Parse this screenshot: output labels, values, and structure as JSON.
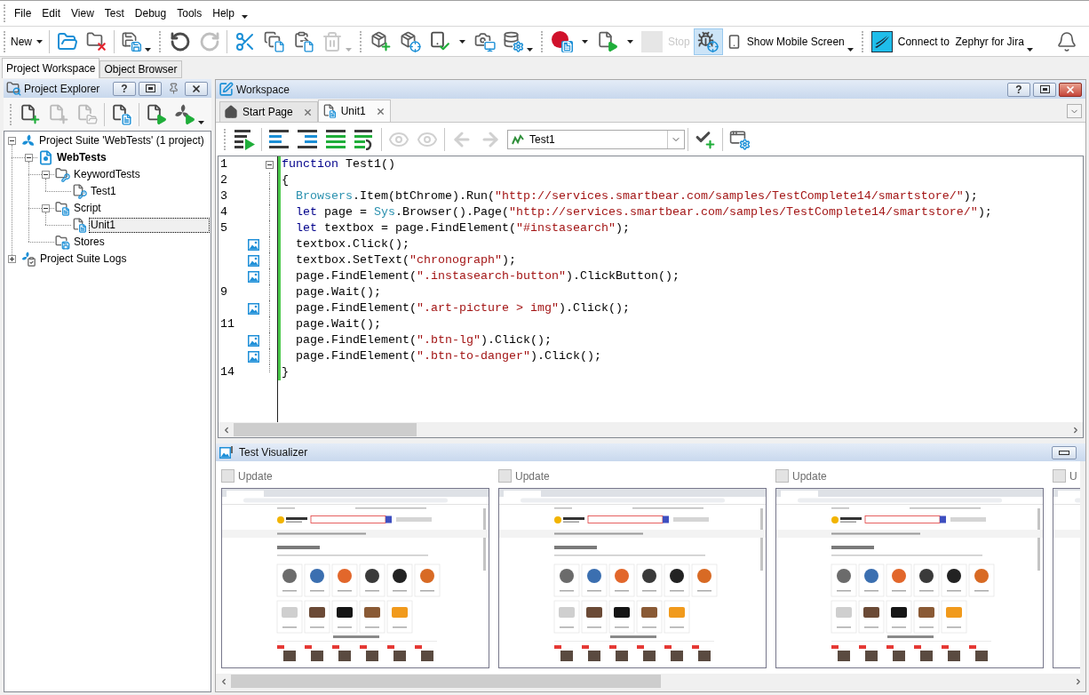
{
  "menu_bar": [
    {
      "label": "File"
    },
    {
      "label": "Edit"
    },
    {
      "label": "View"
    },
    {
      "label": "Test"
    },
    {
      "label": "Debug"
    },
    {
      "label": "Tools"
    },
    {
      "label": "Help"
    }
  ],
  "toolbar": {
    "items": [
      {
        "kind": "menu",
        "label": "New"
      },
      {
        "kind": "separator"
      },
      {
        "kind": "button",
        "disabled": false
      },
      {
        "kind": "button",
        "disabled": false
      },
      {
        "kind": "separator"
      },
      {
        "kind": "dropdown-button",
        "disabled": false
      },
      {
        "kind": "gripper"
      },
      {
        "kind": "button",
        "disabled": false
      },
      {
        "kind": "button",
        "disabled": true
      },
      {
        "kind": "separator"
      },
      {
        "kind": "button",
        "disabled": false
      },
      {
        "kind": "button",
        "disabled": false
      },
      {
        "kind": "button",
        "disabled": false
      },
      {
        "kind": "dropdown-button",
        "disabled": true
      },
      {
        "kind": "gripper"
      },
      {
        "kind": "button",
        "disabled": false
      },
      {
        "kind": "button",
        "disabled": false
      },
      {
        "kind": "split-button",
        "disabled": false
      },
      {
        "kind": "button",
        "disabled": false
      },
      {
        "kind": "dropdown-button",
        "disabled": false
      },
      {
        "kind": "gripper"
      },
      {
        "kind": "split-button",
        "disabled": false
      },
      {
        "kind": "split-button",
        "disabled": false
      },
      {
        "kind": "button",
        "label": "Stop",
        "disabled": true
      },
      {
        "kind": "toggle-button",
        "disabled": false,
        "pressed": true
      },
      {
        "kind": "dropdown-button",
        "label": "Show Mobile Screen",
        "disabled": false
      },
      {
        "kind": "gripper"
      },
      {
        "kind": "dropdown-button",
        "label": "Connect to  Zephyr for Jira",
        "disabled": false
      }
    ]
  },
  "panel_tabs": [
    {
      "label": "Project Workspace",
      "selected": true
    },
    {
      "label": "Object Browser",
      "selected": false
    }
  ],
  "project_explorer": {
    "title": "Project Explorer",
    "focused": false,
    "help_label": "?",
    "toolbar": [
      {
        "kind": "gripper"
      },
      {
        "kind": "button",
        "disabled": false
      },
      {
        "kind": "button",
        "disabled": true
      },
      {
        "kind": "button",
        "disabled": true
      },
      {
        "kind": "separator"
      },
      {
        "kind": "button",
        "disabled": false
      },
      {
        "kind": "separator"
      },
      {
        "kind": "button",
        "disabled": false
      },
      {
        "kind": "dropdown-button",
        "disabled": false
      }
    ],
    "tree": [
      {
        "kind": "suite",
        "label": "Project Suite 'WebTests' (1 project)",
        "expanded": true,
        "selected": false,
        "active": false,
        "children": [
          {
            "kind": "project",
            "label": "WebTests",
            "expanded": true,
            "selected": false,
            "active": true,
            "children": [
              {
                "kind": "keyword-folder",
                "label": "KeywordTests",
                "expanded": true,
                "selected": false,
                "active": false,
                "children": [
                  {
                    "kind": "keyword-test",
                    "label": "Test1",
                    "selected": false,
                    "active": false
                  }
                ]
              },
              {
                "kind": "script-folder",
                "label": "Script",
                "expanded": true,
                "selected": false,
                "active": false,
                "children": [
                  {
                    "kind": "script-unit",
                    "label": "Unit1",
                    "selected": true,
                    "active": false
                  }
                ]
              },
              {
                "kind": "stores-folder",
                "label": "Stores",
                "selected": false,
                "active": false
              }
            ]
          }
        ]
      },
      {
        "kind": "logs",
        "label": "Project Suite Logs",
        "expanded": false,
        "selected": false,
        "active": false
      }
    ]
  },
  "workspace": {
    "title": "Workspace",
    "focused": true,
    "help_label": "?",
    "tabs": [
      {
        "kind": "start-page",
        "label": "Start Page",
        "selected": false
      },
      {
        "kind": "unit",
        "label": "Unit1",
        "selected": true
      }
    ],
    "toolbar": [
      {
        "kind": "gripper"
      },
      {
        "kind": "button",
        "disabled": false
      },
      {
        "kind": "separator"
      },
      {
        "kind": "button",
        "disabled": false
      },
      {
        "kind": "button",
        "disabled": false
      },
      {
        "kind": "button",
        "disabled": false
      },
      {
        "kind": "button",
        "disabled": false
      },
      {
        "kind": "separator"
      },
      {
        "kind": "button",
        "disabled": true
      },
      {
        "kind": "button",
        "disabled": true
      },
      {
        "kind": "separator"
      },
      {
        "kind": "button",
        "disabled": true
      },
      {
        "kind": "button",
        "disabled": true
      },
      {
        "kind": "select",
        "value": "Test1"
      },
      {
        "kind": "separator"
      },
      {
        "kind": "button",
        "disabled": false
      },
      {
        "kind": "separator"
      },
      {
        "kind": "button",
        "disabled": false
      }
    ],
    "code_lines": [
      {
        "kind": "number",
        "number": "1",
        "expanded": true,
        "modified": true,
        "tokens": [
          {
            "kind": "keyword",
            "text": "function"
          },
          {
            "kind": "plain",
            "text": " Test1()"
          }
        ]
      },
      {
        "kind": "number",
        "number": "2",
        "modified": true,
        "tokens": [
          {
            "kind": "plain",
            "text": "{"
          }
        ]
      },
      {
        "kind": "number",
        "number": "3",
        "modified": true,
        "tokens": [
          {
            "kind": "object",
            "text": "  Browsers"
          },
          {
            "kind": "plain",
            "text": ".Item(btChrome).Run("
          },
          {
            "kind": "string",
            "text": "\"http://services.smartbear.com/samples/TestComplete14/smartstore/\""
          },
          {
            "kind": "plain",
            "text": ");"
          }
        ]
      },
      {
        "kind": "number",
        "number": "4",
        "modified": true,
        "tokens": [
          {
            "kind": "keyword",
            "text": "  let"
          },
          {
            "kind": "plain",
            "text": " page = "
          },
          {
            "kind": "object",
            "text": "Sys"
          },
          {
            "kind": "plain",
            "text": ".Browser().Page("
          },
          {
            "kind": "string",
            "text": "\"http://services.smartbear.com/samples/TestComplete14/smartstore/\""
          },
          {
            "kind": "plain",
            "text": ");"
          }
        ]
      },
      {
        "kind": "number",
        "number": "5",
        "modified": true,
        "tokens": [
          {
            "kind": "keyword",
            "text": "  let"
          },
          {
            "kind": "plain",
            "text": " textbox = page.FindElement("
          },
          {
            "kind": "string",
            "text": "\"#instasearch\""
          },
          {
            "kind": "plain",
            "text": ");"
          }
        ]
      },
      {
        "kind": "image",
        "modified": true,
        "tokens": [
          {
            "kind": "plain",
            "text": "  textbox.Click();"
          }
        ]
      },
      {
        "kind": "image",
        "modified": true,
        "tokens": [
          {
            "kind": "plain",
            "text": "  textbox.SetText("
          },
          {
            "kind": "string",
            "text": "\"chronograph\""
          },
          {
            "kind": "plain",
            "text": ");"
          }
        ]
      },
      {
        "kind": "image",
        "modified": true,
        "tokens": [
          {
            "kind": "plain",
            "text": "  page.FindElement("
          },
          {
            "kind": "string",
            "text": "\".instasearch-button\""
          },
          {
            "kind": "plain",
            "text": ").ClickButton();"
          }
        ]
      },
      {
        "kind": "number",
        "number": "9",
        "modified": true,
        "tokens": [
          {
            "kind": "plain",
            "text": "  page.Wait();"
          }
        ]
      },
      {
        "kind": "image",
        "modified": true,
        "tokens": [
          {
            "kind": "plain",
            "text": "  page.FindElement("
          },
          {
            "kind": "string",
            "text": "\".art-picture > img\""
          },
          {
            "kind": "plain",
            "text": ").Click();"
          }
        ]
      },
      {
        "kind": "number",
        "number": "11",
        "modified": true,
        "tokens": [
          {
            "kind": "plain",
            "text": "  page.Wait();"
          }
        ]
      },
      {
        "kind": "image",
        "modified": true,
        "tokens": [
          {
            "kind": "plain",
            "text": "  page.FindElement("
          },
          {
            "kind": "string",
            "text": "\".btn-lg\""
          },
          {
            "kind": "plain",
            "text": ").Click();"
          }
        ]
      },
      {
        "kind": "image",
        "modified": true,
        "tokens": [
          {
            "kind": "plain",
            "text": "  page.FindElement("
          },
          {
            "kind": "string",
            "text": "\".btn-to-danger\""
          },
          {
            "kind": "plain",
            "text": ").Click();"
          }
        ]
      },
      {
        "kind": "number",
        "number": "14",
        "modified": true,
        "tokens": [
          {
            "kind": "plain",
            "text": "}"
          }
        ]
      }
    ]
  },
  "test_visualizer": {
    "title": "Test Visualizer",
    "frames": [
      {
        "label": "Update",
        "checked": false,
        "disabled": true
      },
      {
        "label": "Update",
        "checked": false,
        "disabled": true
      },
      {
        "label": "Update",
        "checked": false,
        "disabled": true
      },
      {
        "label": "U",
        "checked": false,
        "disabled": true
      }
    ]
  }
}
